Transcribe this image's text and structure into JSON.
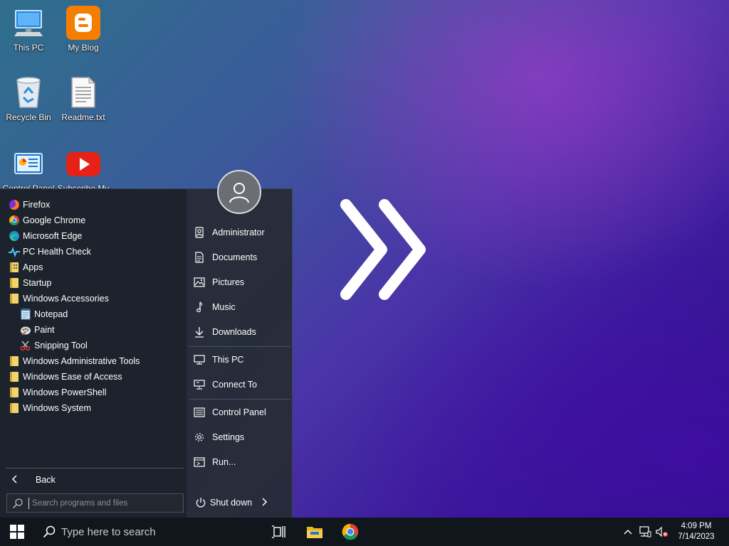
{
  "desktop": {
    "icons": [
      {
        "label": "This PC",
        "icon": "monitor-icon"
      },
      {
        "label": "My Blog",
        "icon": "blogger-icon"
      },
      {
        "label": "Recycle Bin",
        "icon": "recycle-bin-icon"
      },
      {
        "label": "Readme.txt",
        "icon": "text-file-icon"
      },
      {
        "label": "Control Panel",
        "icon": "control-panel-icon"
      },
      {
        "label": "Subscribe My",
        "icon": "youtube-icon"
      }
    ]
  },
  "start_menu": {
    "programs": [
      {
        "label": "Firefox",
        "icon": "firefox-icon"
      },
      {
        "label": "Google Chrome",
        "icon": "chrome-icon"
      },
      {
        "label": "Microsoft Edge",
        "icon": "edge-icon"
      },
      {
        "label": "PC Health Check",
        "icon": "health-check-icon"
      },
      {
        "label": "Apps",
        "icon": "folder-icon"
      },
      {
        "label": "Startup",
        "icon": "folder-icon"
      },
      {
        "label": "Windows Accessories",
        "icon": "folder-icon"
      },
      {
        "label": "Notepad",
        "icon": "notepad-icon"
      },
      {
        "label": "Paint",
        "icon": "paint-icon"
      },
      {
        "label": "Snipping Tool",
        "icon": "snipping-tool-icon"
      },
      {
        "label": "Windows Administrative Tools",
        "icon": "folder-icon"
      },
      {
        "label": "Windows Ease of Access",
        "icon": "folder-icon"
      },
      {
        "label": "Windows PowerShell",
        "icon": "folder-icon"
      },
      {
        "label": "Windows System",
        "icon": "folder-icon"
      }
    ],
    "back_label": "Back",
    "search_placeholder": "Search programs and files",
    "right_items": [
      {
        "label": "Administrator",
        "icon": "user-icon"
      },
      {
        "label": "Documents",
        "icon": "documents-icon"
      },
      {
        "label": "Pictures",
        "icon": "pictures-icon"
      },
      {
        "label": "Music",
        "icon": "music-icon"
      },
      {
        "label": "Downloads",
        "icon": "downloads-icon"
      },
      {
        "label": "This PC",
        "icon": "this-pc-icon"
      },
      {
        "label": "Connect To",
        "icon": "connect-to-icon"
      },
      {
        "label": "Control Panel",
        "icon": "control-panel-icon"
      },
      {
        "label": "Settings",
        "icon": "settings-icon"
      },
      {
        "label": "Run...",
        "icon": "run-icon"
      }
    ],
    "shutdown_label": "Shut down"
  },
  "taskbar": {
    "search_placeholder": "Type here to search",
    "apps": [
      {
        "name": "task-view",
        "icon": "task-view-icon"
      },
      {
        "name": "file-explorer",
        "icon": "folder-icon"
      },
      {
        "name": "google-chrome",
        "icon": "chrome-icon"
      }
    ],
    "time": "4:09 PM",
    "date": "7/14/2023"
  },
  "colors": {
    "menu_bg": "#262c36",
    "taskbar_bg": "#11161d",
    "accent_blue": "#0078d7"
  }
}
